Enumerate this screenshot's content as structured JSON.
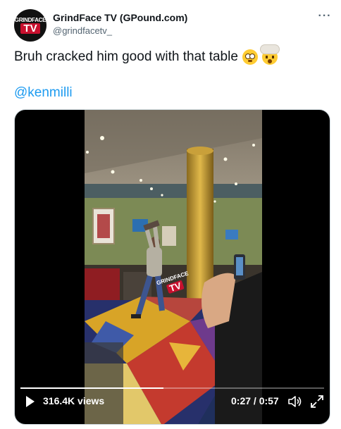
{
  "author": {
    "name": "GrindFace TV (GPound.com)",
    "handle": "@grindfacetv_",
    "avatar_top": "GRINDFACE",
    "avatar_bottom": "TV"
  },
  "more_icon": "more-horizontal-icon",
  "tweet": {
    "text": "Bruh cracked him good with that table",
    "emojis": [
      "flushed-face",
      "exploding-head"
    ],
    "mention": "@kenmilli"
  },
  "video": {
    "watermark_top": "GRINDFACE",
    "watermark_bottom": "TV",
    "views": "316.4K views",
    "time": "0:27 / 0:57",
    "progress": 0.47,
    "icons": [
      "play-icon",
      "volume-icon",
      "fullscreen-icon"
    ]
  },
  "colors": {
    "link": "#1d9bf0",
    "secondary_text": "#536471",
    "primary_text": "#0f1419",
    "brand_red": "#c8102e"
  }
}
